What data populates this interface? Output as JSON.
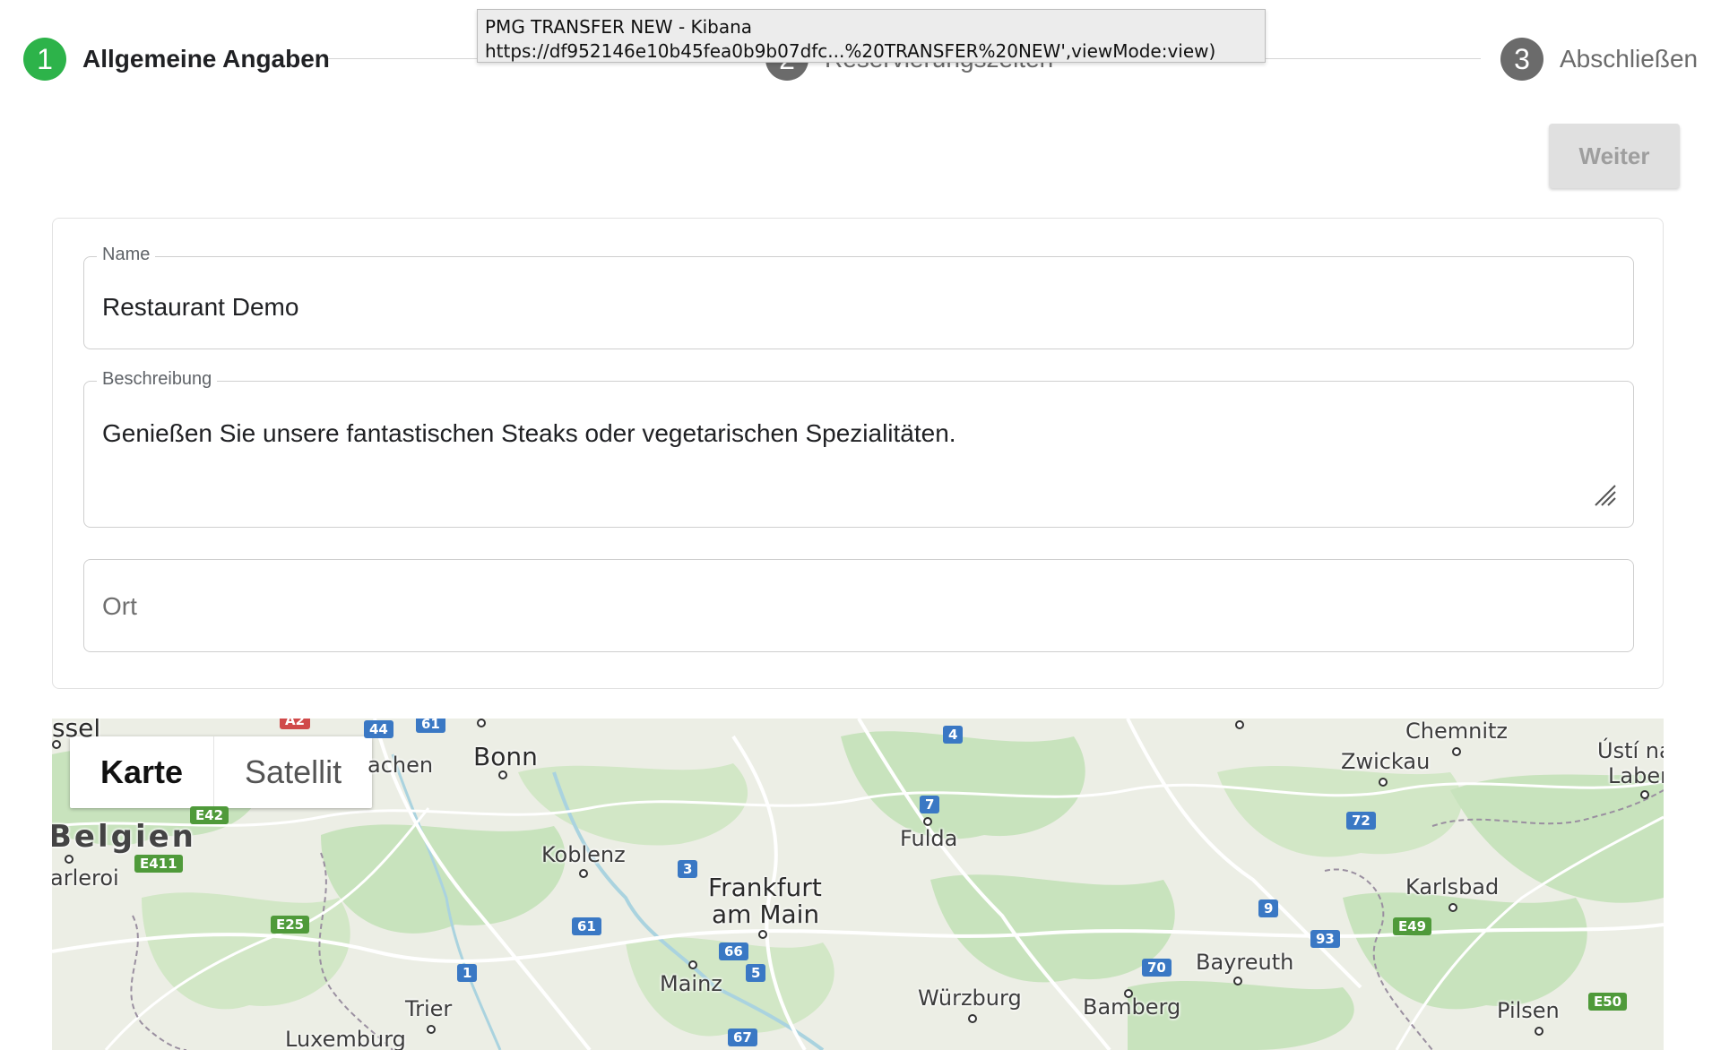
{
  "stepper": {
    "steps": [
      {
        "number": "1",
        "label": "Allgemeine Angaben",
        "state": "active"
      },
      {
        "number": "2",
        "label": "Reservierungszeiten",
        "state": "inactive"
      },
      {
        "number": "3",
        "label": "Abschließen",
        "state": "inactive"
      }
    ]
  },
  "tooltip": {
    "title": "PMG TRANSFER NEW - Kibana",
    "url": "https://df952146e10b45fea0b9b07dfc...%20TRANSFER%20NEW',viewMode:view)"
  },
  "toolbar": {
    "next_label": "Weiter"
  },
  "form": {
    "name": {
      "label": "Name",
      "value": "Restaurant Demo"
    },
    "description": {
      "label": "Beschreibung",
      "value": "Genießen Sie unsere fantastischen Steaks oder vegetarischen Spezialitäten."
    },
    "location": {
      "placeholder": "Ort"
    }
  },
  "map": {
    "type_buttons": {
      "map": "Karte",
      "satellite": "Satellit"
    },
    "labels": {
      "essen": "ssel",
      "aachen": "achen",
      "bonn": "Bonn",
      "belgien": "Belgien",
      "charleroi": "arleroi",
      "koblenz": "Koblenz",
      "frankfurt": "Frankfurt",
      "am_main": "am Main",
      "mainz": "Mainz",
      "fulda": "Fulda",
      "chemnitz": "Chemnitz",
      "zwickau": "Zwickau",
      "usti": "Ústí na",
      "laben": "Laber",
      "karlsbad": "Karlsbad",
      "bayreuth": "Bayreuth",
      "bamberg": "Bamberg",
      "wurzburg": "Würzburg",
      "pilsen": "Pilsen",
      "trier": "Trier",
      "luxemburg": "Luxemburg"
    },
    "shields": {
      "a44": "44",
      "a61a": "61",
      "a2": "A2",
      "a4": "4",
      "a7": "7",
      "a3": "3",
      "a61b": "61",
      "a66": "66",
      "a5": "5",
      "a1": "1",
      "a67": "67",
      "a72": "72",
      "a9": "9",
      "a93": "93",
      "a70": "70",
      "e42": "E42",
      "e411": "E411",
      "e25": "E25",
      "e49": "E49",
      "e50": "E50"
    },
    "colors": {
      "land": "#eceee5",
      "forest": "#c8e3bd",
      "road": "#ffffff",
      "water": "#aad3df"
    }
  }
}
